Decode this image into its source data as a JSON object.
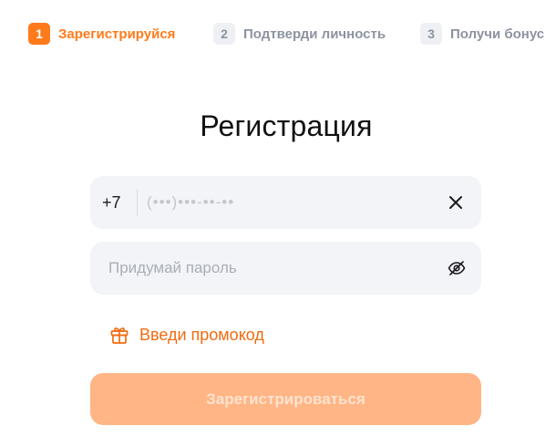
{
  "stepper": {
    "steps": [
      {
        "number": "1",
        "label": "Зарегистрируйся",
        "state": "active"
      },
      {
        "number": "2",
        "label": "Подтверди личность",
        "state": "inactive"
      },
      {
        "number": "3",
        "label": "Получи бонус",
        "state": "inactive"
      }
    ]
  },
  "form": {
    "title": "Регистрация",
    "phone": {
      "country_code": "+7",
      "value": "",
      "placeholder": "(•••)•••-••-••",
      "clear_icon": "close-icon"
    },
    "password": {
      "value": "",
      "placeholder": "Придумай пароль",
      "toggle_icon": "eye-off-icon"
    },
    "promo": {
      "label": "Введи промокод",
      "icon": "gift-icon"
    },
    "submit": {
      "label": "Зарегистрироваться",
      "enabled": false
    }
  },
  "colors": {
    "accent": "#ff7a1a",
    "accent_disabled": "#ffb585",
    "field_bg": "#f3f4f7",
    "muted_text": "#8d93a0"
  }
}
